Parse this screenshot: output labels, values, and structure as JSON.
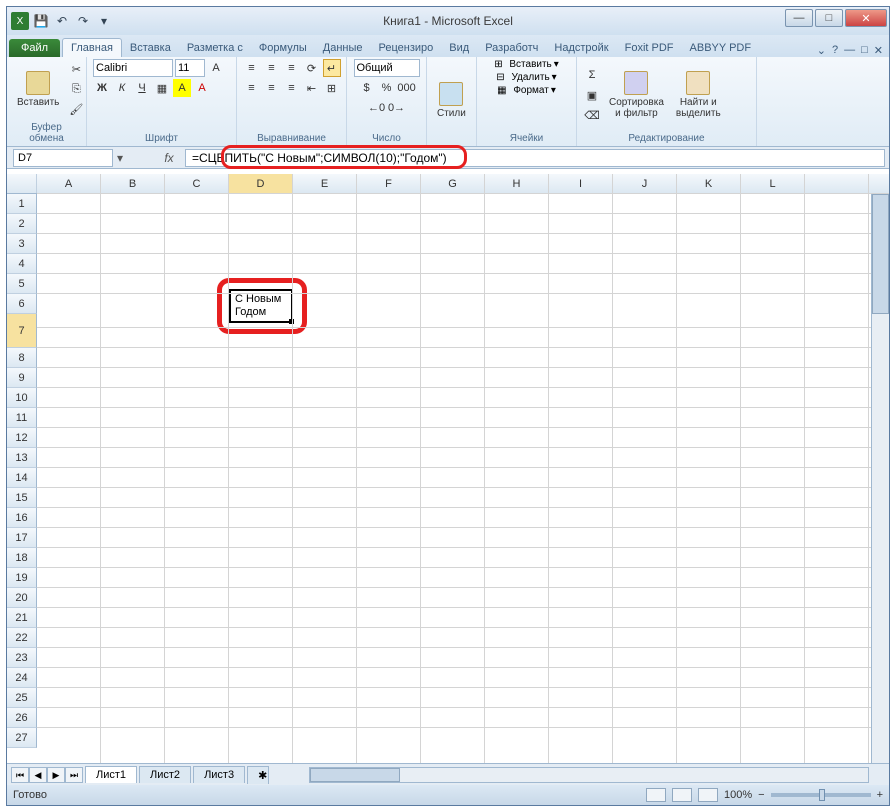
{
  "title": "Книга1 - Microsoft Excel",
  "tabs": {
    "file": "Файл",
    "home": "Главная",
    "insert": "Вставка",
    "layout": "Разметка с",
    "formulas": "Формулы",
    "data": "Данные",
    "review": "Рецензиро",
    "view": "Вид",
    "developer": "Разработч",
    "addins": "Надстройк",
    "foxit": "Foxit PDF",
    "abbyy": "ABBYY PDF"
  },
  "ribbon": {
    "clipboard": {
      "paste": "Вставить",
      "label": "Буфер обмена"
    },
    "font": {
      "name": "Calibri",
      "size": "11",
      "label": "Шрифт"
    },
    "alignment": {
      "label": "Выравнивание"
    },
    "number": {
      "format": "Общий",
      "label": "Число"
    },
    "styles": {
      "btn": "Стили",
      "label": ""
    },
    "cells": {
      "insert": "Вставить",
      "delete": "Удалить",
      "format": "Формат",
      "label": "Ячейки"
    },
    "editing": {
      "sort": "Сортировка\nи фильтр",
      "find": "Найти и\nвыделить",
      "label": "Редактирование"
    }
  },
  "name_box": "D7",
  "formula": "=СЦЕПИТЬ(\"С Новым\";СИМВОЛ(10);\"Годом\")",
  "cell_value_line1": "С Новым",
  "cell_value_line2": "Годом",
  "columns": [
    "A",
    "B",
    "C",
    "D",
    "E",
    "F",
    "G",
    "H",
    "I",
    "J",
    "K",
    "L"
  ],
  "sheets": {
    "s1": "Лист1",
    "s2": "Лист2",
    "s3": "Лист3"
  },
  "status": "Готово",
  "zoom": "100%"
}
